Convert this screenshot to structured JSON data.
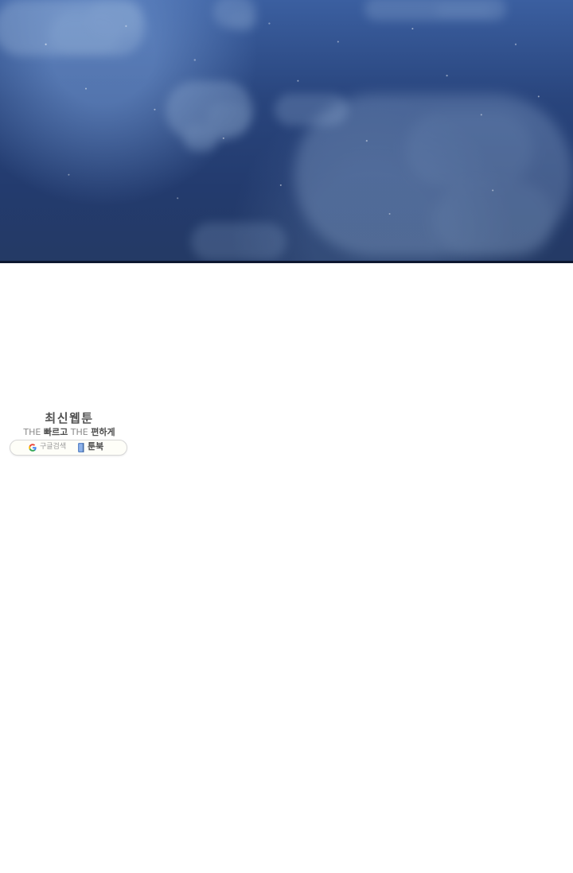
{
  "scene": {
    "panel": {
      "background_colors": [
        "#3b5fa0",
        "#29457d",
        "#233b6e"
      ],
      "border_color": "#0d1730"
    }
  },
  "promo": {
    "title": "최신웹툰",
    "subtitle": {
      "the_1": "THE",
      "word_1": "빠르고",
      "the_2": "THE",
      "word_2": "편하게"
    },
    "search_pill": {
      "google_label": "구글검색",
      "book_label": "툰북",
      "google_icon": "google-icon",
      "book_icon": "book-icon"
    }
  }
}
